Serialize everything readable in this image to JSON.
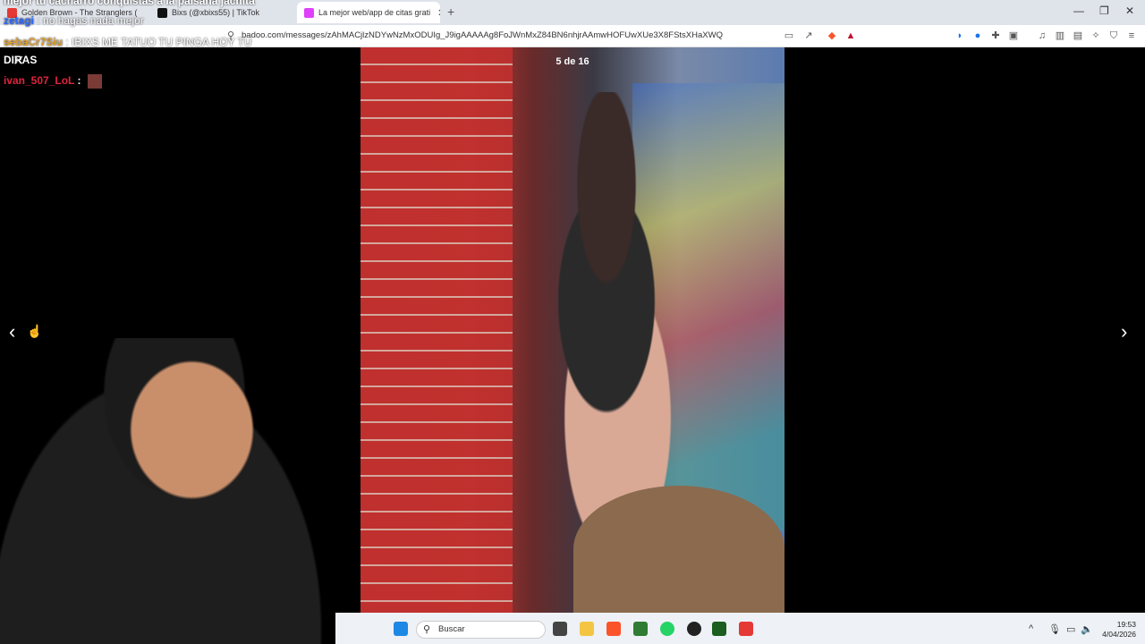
{
  "browser": {
    "tabs": [
      {
        "title": "Golden Brown - The Stranglers (",
        "color": "#e53935"
      },
      {
        "title": "Bixs (@xbixs55) | TikTok",
        "color": "#111111"
      },
      {
        "title": "La mejor web/app de citas grati",
        "color": "#e040fb",
        "active": true
      }
    ],
    "url": "badoo.com/messages/zAhMACjlzNDYwNzMxODUIg_J9igAAAAAg8FoJWnMxZ84BN6nhjrAAmwHOFUwXUe3X8FStsXHaXWQ"
  },
  "viewer": {
    "counter": "5 de 16",
    "prev_icon": "chevron-left-icon",
    "next_icon": "chevron-right-icon",
    "close_icon": "close-icon"
  },
  "stream_overlay": {
    "line1": "mejor tu cacharro conquistas a la paisana jachita",
    "line2_user": "zetagi",
    "line2_text": ": no hagas nada mejor",
    "line3_user": "sebaCr7Siu",
    "line3_text": ": IBIXS ME TATUO TU PINGA HOY TU",
    "line4": "DIRAS",
    "line5_user": "ivan_507_LoL",
    "line5_text": ":",
    "colors": {
      "line1": "#ffffff",
      "zetagi": "#2f6cff",
      "sebaCr7Siu": "#e0a030",
      "ivan": "#e0243d"
    }
  },
  "taskbar": {
    "search_placeholder": "Buscar",
    "time": "19:53",
    "date": "4/04/2026"
  }
}
